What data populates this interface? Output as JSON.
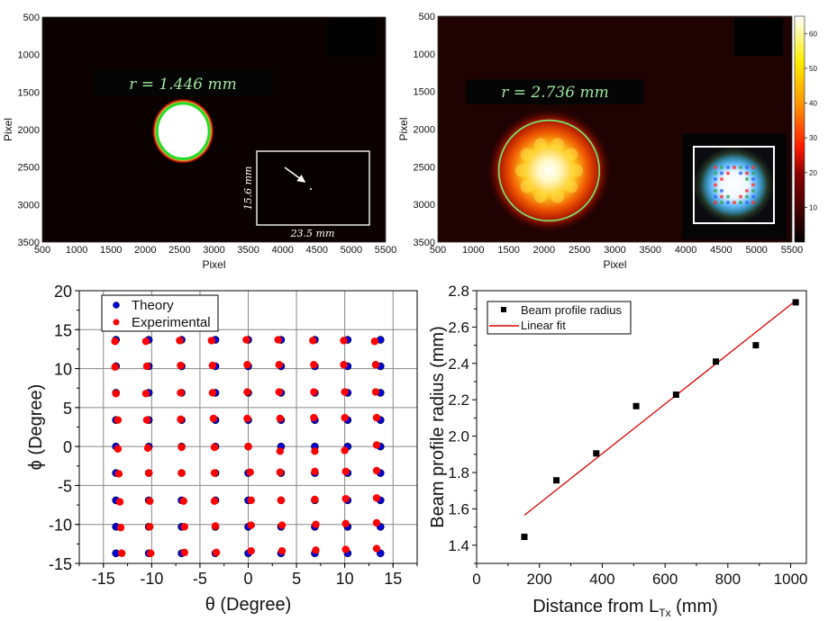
{
  "chart_data": [
    {
      "type": "heatmap",
      "panel": "top-left",
      "title": "",
      "xlabel": "Pixel",
      "ylabel": "Pixel",
      "xlim": [
        500,
        5500
      ],
      "ylim": [
        3500,
        500
      ],
      "xticks": [
        "500",
        "1000",
        "1500",
        "2000",
        "2500",
        "3000",
        "3500",
        "4000",
        "4500",
        "5000",
        "5500"
      ],
      "yticks": [
        "500",
        "1000",
        "1500",
        "2000",
        "2500",
        "3000",
        "3500"
      ],
      "annotation": "r = 1.446 mm",
      "beam_center": {
        "x": 2550,
        "y": 2020
      },
      "fit_circle": {
        "cx": 2550,
        "cy": 2020,
        "rx_pixels": 380,
        "ry_pixels": 370
      },
      "inset": {
        "width_label": "23.5 mm",
        "height_label": "15.6 mm",
        "description": "full sensor view with arrow pointing to beam spot"
      },
      "colors": {
        "background": "#0b0000",
        "fit_circle": "#22dd22",
        "annotation_text": "#9ee89e"
      }
    },
    {
      "type": "heatmap",
      "panel": "top-right",
      "title": "",
      "xlabel": "Pixel",
      "ylabel": "Pixel",
      "xlim": [
        500,
        5500
      ],
      "ylim": [
        3500,
        500
      ],
      "xticks": [
        "500",
        "1000",
        "1500",
        "2000",
        "2500",
        "3000",
        "3500",
        "4000",
        "4500",
        "5000",
        "5500"
      ],
      "yticks": [
        "500",
        "1000",
        "1500",
        "2000",
        "2500",
        "3000",
        "3500"
      ],
      "annotation": "r = 2.736 mm",
      "beam_center": {
        "x": 2070,
        "y": 2550
      },
      "fit_circle": {
        "cx": 2070,
        "cy": 2550,
        "r_pixels": 710
      },
      "colorbar": {
        "range": [
          0,
          65
        ],
        "ticks": [
          "10",
          "20",
          "30",
          "40",
          "50",
          "60"
        ],
        "colormap": "hot"
      },
      "inset": {
        "description": "RGB photo of beam array pattern"
      },
      "colors": {
        "fit_circle": "#77dd66",
        "annotation_text": "#9ee89e"
      }
    },
    {
      "type": "scatter",
      "panel": "bottom-left",
      "title": "",
      "xlabel": "θ (Degree)",
      "ylabel": "ϕ (Degree)",
      "xlim": [
        -17.5,
        17.5
      ],
      "ylim": [
        -15,
        20
      ],
      "xticks": [
        "-15",
        "-10",
        "-5",
        "0",
        "5",
        "10",
        "15"
      ],
      "yticks": [
        "20",
        "15",
        "10",
        "5",
        "0",
        "-5",
        "-10",
        "-15"
      ],
      "grid": true,
      "legend_position": "top-left",
      "series": [
        {
          "name": "Theory",
          "color": "#0000dd",
          "grid_values": [
            -13.7,
            -10.3,
            -6.9,
            -3.4,
            0,
            3.4,
            6.9,
            10.3,
            13.7
          ],
          "note": "9x9 grid of points at all combinations of grid_values for θ and ϕ"
        },
        {
          "name": "Experimental",
          "color": "#ff0000",
          "points": [
            [
              -13.8,
              13.5
            ],
            [
              -10.6,
              13.5
            ],
            [
              -7.1,
              13.6
            ],
            [
              -3.8,
              13.6
            ],
            [
              -0.2,
              13.7
            ],
            [
              3.1,
              13.7
            ],
            [
              6.7,
              13.6
            ],
            [
              9.9,
              13.6
            ],
            [
              13.1,
              13.5
            ],
            [
              -13.8,
              10.2
            ],
            [
              -10.5,
              10.3
            ],
            [
              -7.0,
              10.4
            ],
            [
              -3.7,
              10.4
            ],
            [
              -0.1,
              10.5
            ],
            [
              3.2,
              10.5
            ],
            [
              6.8,
              10.5
            ],
            [
              9.9,
              10.5
            ],
            [
              13.2,
              10.5
            ],
            [
              -13.7,
              6.8
            ],
            [
              -10.6,
              6.8
            ],
            [
              -7.0,
              6.9
            ],
            [
              -3.7,
              6.9
            ],
            [
              -0.1,
              7.0
            ],
            [
              3.2,
              7.0
            ],
            [
              6.8,
              7.0
            ],
            [
              10.0,
              7.0
            ],
            [
              13.2,
              7.0
            ],
            [
              -13.5,
              3.4
            ],
            [
              -10.5,
              3.4
            ],
            [
              -7.0,
              3.5
            ],
            [
              -3.6,
              3.6
            ],
            [
              -0.1,
              3.6
            ],
            [
              3.3,
              3.6
            ],
            [
              6.8,
              3.7
            ],
            [
              10.0,
              3.7
            ],
            [
              13.3,
              3.7
            ],
            [
              -13.5,
              -0.3
            ],
            [
              -10.4,
              -0.2
            ],
            [
              -6.9,
              -0.1
            ],
            [
              -3.5,
              -0.1
            ],
            [
              0,
              0
            ],
            [
              3.3,
              -0.6
            ],
            [
              6.9,
              -0.6
            ],
            [
              10.0,
              -0.5
            ],
            [
              13.3,
              0.2
            ],
            [
              -13.4,
              -3.5
            ],
            [
              -10.3,
              -3.4
            ],
            [
              -6.9,
              -3.4
            ],
            [
              -3.5,
              -3.4
            ],
            [
              0.2,
              -3.3
            ],
            [
              3.3,
              -3.3
            ],
            [
              6.9,
              -3.2
            ],
            [
              10.1,
              -3.2
            ],
            [
              13.3,
              -3.1
            ],
            [
              -13.3,
              -7.1
            ],
            [
              -10.2,
              -7.0
            ],
            [
              -6.7,
              -7.0
            ],
            [
              -3.5,
              -7.0
            ],
            [
              0.3,
              -6.9
            ],
            [
              3.4,
              -6.9
            ],
            [
              6.9,
              -6.8
            ],
            [
              10.1,
              -6.7
            ],
            [
              13.3,
              -6.6
            ],
            [
              -13.2,
              -10.4
            ],
            [
              -10.2,
              -10.3
            ],
            [
              -6.6,
              -10.3
            ],
            [
              -3.4,
              -10.2
            ],
            [
              0.3,
              -10.1
            ],
            [
              3.5,
              -10.1
            ],
            [
              7.0,
              -10.0
            ],
            [
              10.1,
              -9.9
            ],
            [
              13.3,
              -9.8
            ],
            [
              -13.1,
              -13.7
            ],
            [
              -10.1,
              -13.7
            ],
            [
              -6.6,
              -13.6
            ],
            [
              -3.3,
              -13.6
            ],
            [
              0.3,
              -13.4
            ],
            [
              3.5,
              -13.4
            ],
            [
              7.0,
              -13.3
            ],
            [
              10.1,
              -13.2
            ],
            [
              13.3,
              -13.1
            ]
          ]
        }
      ]
    },
    {
      "type": "scatter",
      "panel": "bottom-right",
      "title": "",
      "xlabel": "Distance from L",
      "xlabel_subscript": "Tx",
      "xlabel_suffix": " (mm)",
      "ylabel": "Beam profile radius (mm)",
      "xlim": [
        0,
        1050
      ],
      "ylim": [
        1.3,
        2.8
      ],
      "xticks": [
        "0",
        "200",
        "400",
        "600",
        "800",
        "1000"
      ],
      "yticks": [
        "1.4",
        "1.6",
        "1.8",
        "2.0",
        "2.2",
        "2.4",
        "2.6",
        "2.8"
      ],
      "grid": false,
      "legend_position": "top-left",
      "series": [
        {
          "name": "Beam profile radius",
          "marker": "square",
          "color": "#000000",
          "x": [
            152,
            254,
            381,
            508,
            635,
            762,
            889,
            1016
          ],
          "y": [
            1.446,
            1.757,
            1.905,
            2.165,
            2.228,
            2.41,
            2.5,
            2.736
          ]
        },
        {
          "name": "Linear fit",
          "type": "line",
          "color": "#dd0000",
          "x": [
            152,
            1016
          ],
          "y": [
            1.565,
            2.745
          ]
        }
      ]
    }
  ]
}
